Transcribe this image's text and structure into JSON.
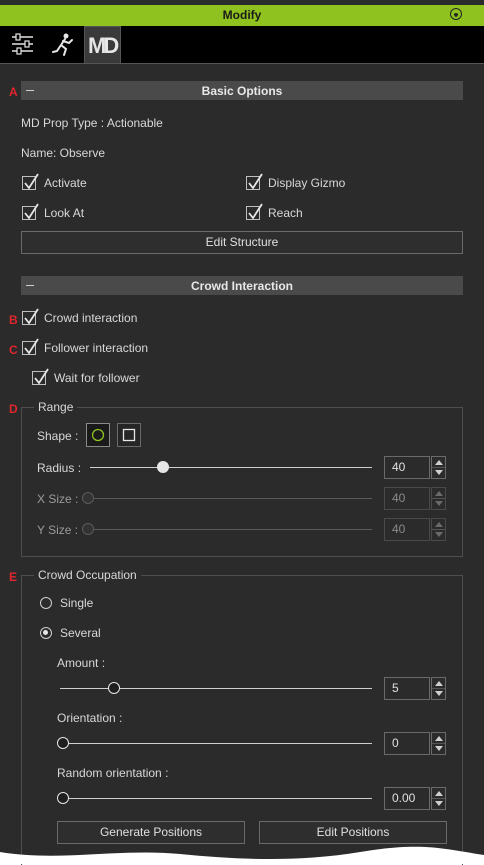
{
  "window": {
    "title": "Modify"
  },
  "tabs": [
    {
      "icon": "sliders-icon"
    },
    {
      "icon": "motion-figure-icon"
    },
    {
      "icon": "md-logo-icon",
      "label": "MD"
    }
  ],
  "markers": {
    "a": "A",
    "b": "B",
    "c": "C",
    "d": "D",
    "e": "E"
  },
  "basic": {
    "header": "Basic Options",
    "prop_type": "MD Prop Type : Actionable",
    "name": "Name: Observe",
    "activate_label": "Activate",
    "display_gizmo_label": "Display Gizmo",
    "lookat_label": "Look At",
    "reach_label": "Reach",
    "edit_structure_label": "Edit Structure"
  },
  "crowd": {
    "header": "Crowd Interaction",
    "crowd_interaction_label": "Crowd interaction",
    "follower_interaction_label": "Follower interaction",
    "wait_follower_label": "Wait for follower"
  },
  "range": {
    "title": "Range",
    "shape_label": "Shape :",
    "shape_selected": "circle",
    "radius_label": "Radius :",
    "radius_value": "40",
    "radius_slider": 0.25,
    "xsize_label": "X Size :",
    "xsize_value": "40",
    "ysize_label": "Y Size :",
    "ysize_value": "40"
  },
  "occupation": {
    "title": "Crowd Occupation",
    "single_label": "Single",
    "several_label": "Several",
    "selected": "Several",
    "amount_label": "Amount :",
    "amount_value": "5",
    "amount_slider": 0.17,
    "orientation_label": "Orientation :",
    "orientation_value": "0",
    "random_orientation_label": "Random orientation :",
    "random_orientation_value": "0.00",
    "generate_label": "Generate Positions",
    "edit_positions_label": "Edit Positions"
  },
  "colors": {
    "title_bar": "#8fc21f",
    "marker": "#e0262c",
    "panel_bg": "#2b2b2b"
  }
}
